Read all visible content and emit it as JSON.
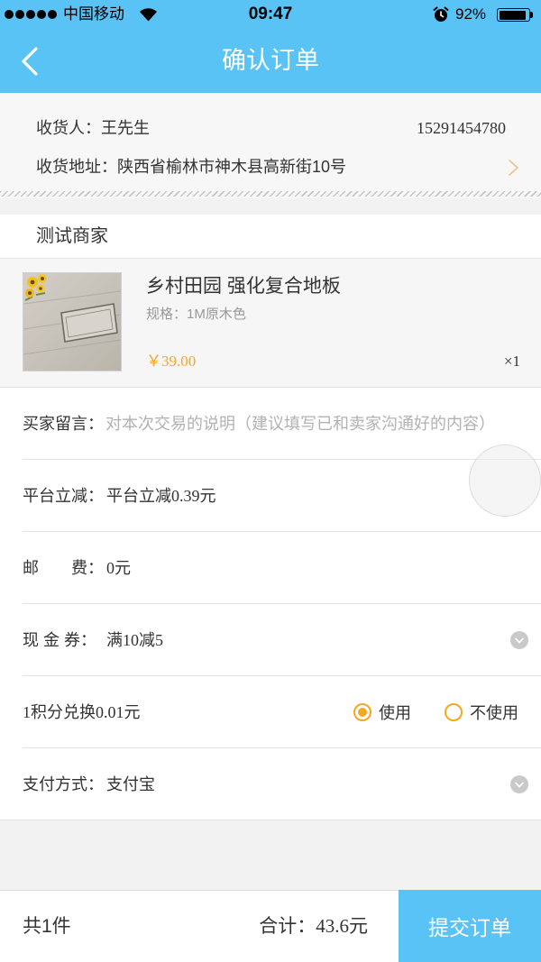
{
  "status_bar": {
    "carrier": "中国移动",
    "time": "09:47",
    "battery": "92%",
    "battery_level": 0.92
  },
  "nav": {
    "title": "确认订单"
  },
  "address": {
    "receiver_label": "收货人：",
    "receiver_name": "王先生",
    "phone": "15291454780",
    "address_label": "收货地址：",
    "address_value": "陕西省榆林市神木县高新街10号"
  },
  "shop": {
    "name": "测试商家"
  },
  "product": {
    "title": "乡村田园 强化复合地板",
    "spec": "规格：1M原木色",
    "price": "￥39.00",
    "quantity": "×1"
  },
  "form": {
    "message_label": "买家留言：",
    "message_placeholder": "对本次交易的说明（建议填写已和卖家沟通好的内容）",
    "discount_label": "平台立减：",
    "discount_value": "平台立减0.39元",
    "shipping_label": "邮　　费：",
    "shipping_value": "0元",
    "coupon_label": "现 金 券：",
    "coupon_value": "满10减5",
    "points_label": "1积分兑换0.01元",
    "points_options": [
      {
        "label": "使用",
        "selected": true
      },
      {
        "label": "不使用",
        "selected": false
      }
    ],
    "payment_label": "支付方式：",
    "payment_value": "支付宝"
  },
  "footer": {
    "count": "共1件",
    "total_label": "合计：",
    "total_value": "43.6元",
    "submit_label": "提交订单"
  },
  "icons": {
    "signal": "signal-strength-icon",
    "wifi": "wifi-icon",
    "alarm": "alarm-icon",
    "battery": "battery-icon",
    "back": "chevron-left-icon",
    "address_more": "chevron-right-icon",
    "dropdown": "chevron-down-circle-icon"
  },
  "colors": {
    "primary": "#5ac3f6",
    "accent": "#f5a623",
    "text": "#333333",
    "muted": "#999999"
  }
}
